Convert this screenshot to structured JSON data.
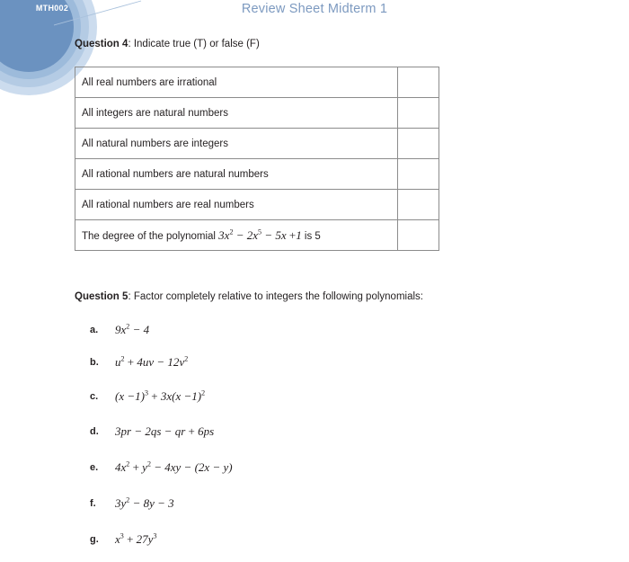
{
  "header": {
    "course_code": "MTH002",
    "title": "Review Sheet Midterm 1",
    "title_color": "#7d9ac0",
    "logo_colors": {
      "outer_ring": "#ccdcee",
      "mid_ring": "#b4cbe4",
      "inner_ring": "#9dbbdb",
      "core": "#6b92c0",
      "code_text": "#ffffff"
    }
  },
  "question4": {
    "label": "Question 4",
    "prompt": ":  Indicate true (T) or false (F)",
    "table": {
      "rows": [
        {
          "statement": "All real numbers are irrational",
          "answer": ""
        },
        {
          "statement": "All integers are natural numbers",
          "answer": ""
        },
        {
          "statement": "All natural numbers are integers",
          "answer": ""
        },
        {
          "statement": "All rational numbers are natural numbers",
          "answer": ""
        },
        {
          "statement": "All rational numbers are real numbers",
          "answer": ""
        },
        {
          "statement_prefix": "The degree of the polynomial ",
          "statement_math": "3x² − 2x⁵ − 5x + 1",
          "statement_suffix": " is 5",
          "answer": ""
        }
      ]
    }
  },
  "question5": {
    "label": "Question 5",
    "prompt": ":  Factor completely relative to integers the following polynomials:",
    "items": [
      {
        "letter": "a.",
        "expression": "9x² − 4"
      },
      {
        "letter": "b.",
        "expression": "u² + 4uv − 12v²"
      },
      {
        "letter": "c.",
        "expression": "(x − 1)³ + 3x(x − 1)²"
      },
      {
        "letter": "d.",
        "expression": "3pr − 2qs − qr + 6ps"
      },
      {
        "letter": "e.",
        "expression": "4x² + y² − 4xy − (2x − y)"
      },
      {
        "letter": "f.",
        "expression": "3y² − 8y − 3"
      },
      {
        "letter": "g.",
        "expression": "x³ + 27y³"
      }
    ]
  }
}
